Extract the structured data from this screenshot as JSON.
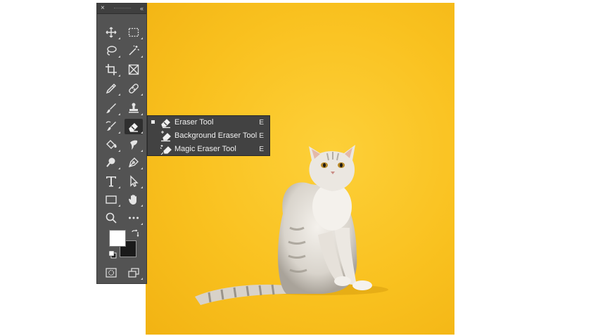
{
  "toolbar": {
    "close_glyph": "×",
    "collapse_glyph": "‹‹",
    "tools": [
      {
        "name": "move-tool",
        "icon": "move-icon"
      },
      {
        "name": "rectangular-marquee-tool",
        "icon": "marquee-icon"
      },
      {
        "name": "lasso-tool",
        "icon": "lasso-icon"
      },
      {
        "name": "magic-wand-tool",
        "icon": "magic-wand-icon"
      },
      {
        "name": "crop-tool",
        "icon": "crop-icon"
      },
      {
        "name": "frame-tool",
        "icon": "frame-icon"
      },
      {
        "name": "eyedropper-tool",
        "icon": "eyedropper-icon"
      },
      {
        "name": "healing-brush-tool",
        "icon": "bandage-icon"
      },
      {
        "name": "brush-tool",
        "icon": "brush-icon"
      },
      {
        "name": "clone-stamp-tool",
        "icon": "stamp-icon"
      },
      {
        "name": "history-brush-tool",
        "icon": "history-brush-icon"
      },
      {
        "name": "eraser-tool",
        "icon": "eraser-icon",
        "active": true
      },
      {
        "name": "paint-bucket-tool",
        "icon": "paint-bucket-icon"
      },
      {
        "name": "smudge-tool",
        "icon": "smudge-icon"
      },
      {
        "name": "dodge-tool",
        "icon": "dodge-icon"
      },
      {
        "name": "pen-tool",
        "icon": "pen-icon"
      },
      {
        "name": "type-tool",
        "icon": "type-icon"
      },
      {
        "name": "path-selection-tool",
        "icon": "arrow-icon"
      },
      {
        "name": "rectangle-tool",
        "icon": "rectangle-icon"
      },
      {
        "name": "hand-tool",
        "icon": "hand-icon"
      },
      {
        "name": "zoom-tool",
        "icon": "zoom-icon"
      },
      {
        "name": "edit-toolbar",
        "icon": "more-icon"
      }
    ],
    "foreground_color": "#ffffff",
    "background_color": "#1a1a1a"
  },
  "flyout": {
    "items": [
      {
        "label": "Eraser Tool",
        "shortcut": "E",
        "selected": true,
        "icon": "eraser-icon"
      },
      {
        "label": "Background Eraser Tool",
        "shortcut": "E",
        "selected": false,
        "icon": "background-eraser-icon"
      },
      {
        "label": "Magic Eraser Tool",
        "shortcut": "E",
        "selected": false,
        "icon": "magic-eraser-icon"
      }
    ]
  },
  "colors": {
    "canvas_bg": "#f9c11f",
    "panel": "#535353",
    "flyout": "#424242"
  }
}
